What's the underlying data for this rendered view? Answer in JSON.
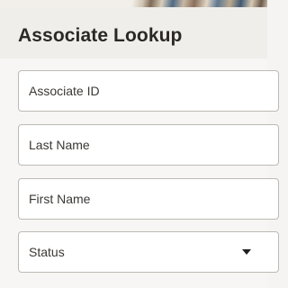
{
  "header": {
    "title": "Associate Lookup"
  },
  "form": {
    "associate_id": {
      "placeholder": "Associate ID",
      "value": ""
    },
    "last_name": {
      "placeholder": "Last Name",
      "value": ""
    },
    "first_name": {
      "placeholder": "First Name",
      "value": ""
    },
    "status": {
      "label": "Status",
      "icon": "caret-down-icon"
    }
  }
}
